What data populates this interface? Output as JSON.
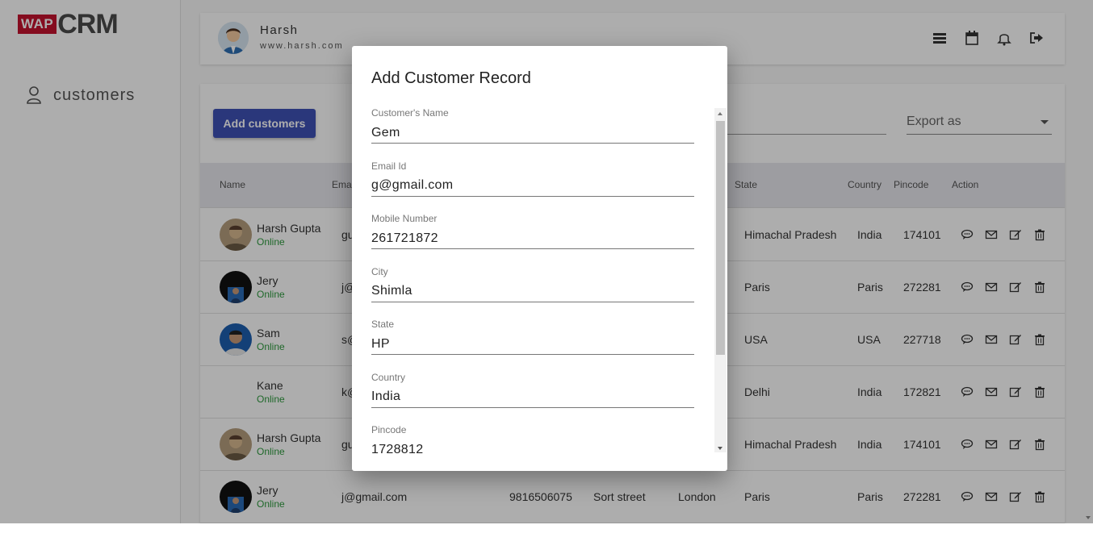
{
  "logo": {
    "part1": "WAP",
    "part2": "CRM"
  },
  "sidebar": {
    "items": [
      {
        "label": "customers",
        "icon": "user-icon"
      }
    ]
  },
  "header": {
    "user_name": "Harsh",
    "user_site": "www.harsh.com",
    "icons": [
      "list-icon",
      "calendar-icon",
      "bell-icon",
      "logout-icon"
    ]
  },
  "toolbar": {
    "add_label": "Add customers",
    "export_label": "Export as"
  },
  "table": {
    "columns": {
      "name": "Name",
      "email": "Email",
      "state": "State",
      "country": "Country",
      "pincode": "Pincode",
      "action": "Action"
    },
    "rows": [
      {
        "name": "Harsh Gupta",
        "status": "Online",
        "email": "gu",
        "mobile": "",
        "street": "",
        "city": "",
        "state": "Himachal Pradesh",
        "country": "India",
        "pincode": "174101"
      },
      {
        "name": "Jery",
        "status": "Online",
        "email": "j@",
        "mobile": "",
        "street": "",
        "city": "",
        "state": "Paris",
        "country": "Paris",
        "pincode": "272281"
      },
      {
        "name": "Sam",
        "status": "Online",
        "email": "s@",
        "mobile": "",
        "street": "",
        "city": "",
        "state": "USA",
        "country": "USA",
        "pincode": "227718"
      },
      {
        "name": "Kane",
        "status": "Online",
        "email": "k@",
        "mobile": "",
        "street": "",
        "city": "",
        "state": "Delhi",
        "country": "India",
        "pincode": "172821"
      },
      {
        "name": "Harsh Gupta",
        "status": "Online",
        "email": "gu",
        "mobile": "",
        "street": "",
        "city": "",
        "state": "Himachal Pradesh",
        "country": "India",
        "pincode": "174101"
      },
      {
        "name": "Jery",
        "status": "Online",
        "email": "j@gmail.com",
        "mobile": "9816506075",
        "street": "Sort street",
        "city": "London",
        "state": "Paris",
        "country": "Paris",
        "pincode": "272281"
      }
    ]
  },
  "dialog": {
    "title": "Add Customer Record",
    "fields": [
      {
        "label": "Customer's Name",
        "value": "Gem"
      },
      {
        "label": "Email Id",
        "value": "g@gmail.com"
      },
      {
        "label": "Mobile Number",
        "value": "261721872"
      },
      {
        "label": "City",
        "value": "Shimla"
      },
      {
        "label": "State",
        "value": "HP"
      },
      {
        "label": "Country",
        "value": "India"
      },
      {
        "label": "Pincode",
        "value": "1728812"
      }
    ]
  },
  "colors": {
    "primary": "#3f51b5",
    "brand_red": "#c4122f",
    "online_green": "#2e9a3e"
  }
}
